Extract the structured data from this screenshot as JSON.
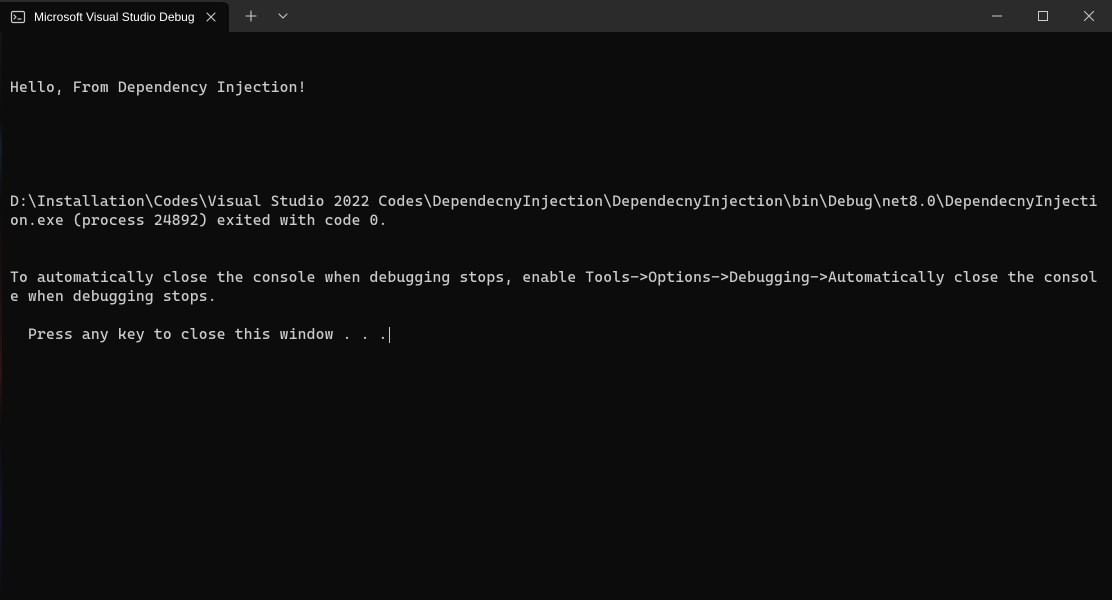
{
  "titlebar": {
    "tab_title": "Microsoft Visual Studio Debug"
  },
  "terminal": {
    "lines": [
      "Hello, From Dependency Injection!",
      "",
      "D:\\Installation\\Codes\\Visual Studio 2022 Codes\\DependecnyInjection\\DependecnyInjection\\bin\\Debug\\net8.0\\DependecnyInjection.exe (process 24892) exited with code 0.",
      "To automatically close the console when debugging stops, enable Tools->Options->Debugging->Automatically close the console when debugging stops.",
      "Press any key to close this window . . ."
    ]
  }
}
